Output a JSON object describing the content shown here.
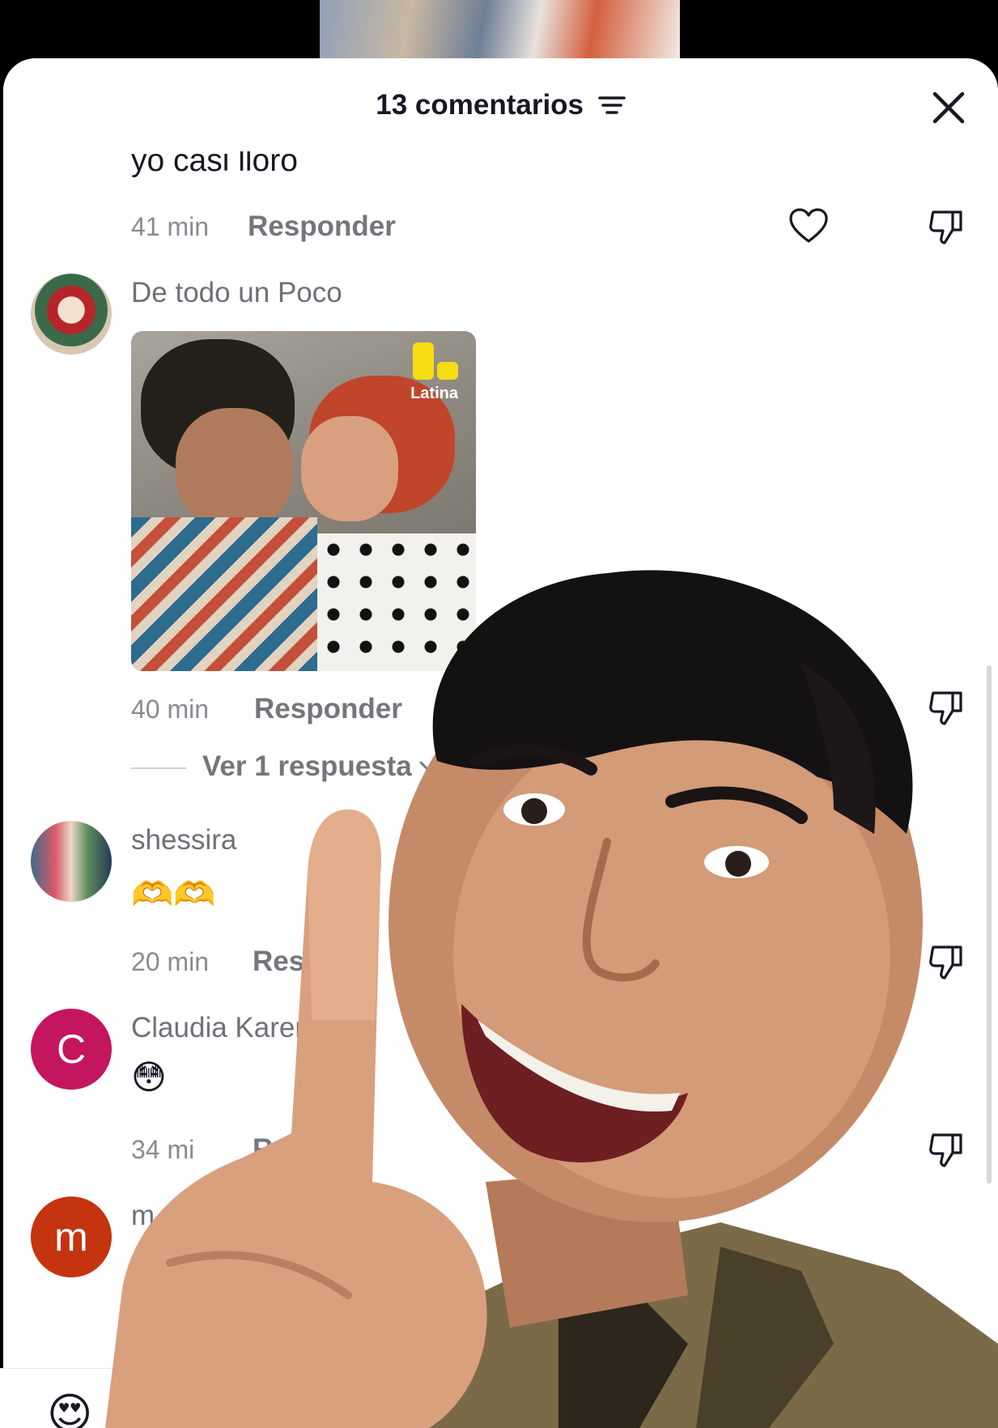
{
  "header": {
    "title": "13 comentarios"
  },
  "comments": [
    {
      "text": "yo casi lloro",
      "time": "41 min",
      "reply": "Responder"
    },
    {
      "name": "De todo un Poco",
      "photo_watermark": "Latina",
      "time": "40 min",
      "reply": "Responder",
      "view_replies": "Ver 1 respuesta"
    },
    {
      "name": "shessira",
      "emoji": "🫶🫶",
      "time": "20 min",
      "reply": "Respon"
    },
    {
      "name": "Claudia Karen",
      "avatar_letter": "C",
      "avatar_color": "#c4155f",
      "emoji": "😳",
      "time": "34 mi",
      "reply": "R"
    },
    {
      "name": "m",
      "avatar_letter": "m",
      "avatar_color": "#c4340e"
    }
  ],
  "bottom_bar": {
    "emoji": "😍"
  },
  "colors": {
    "accent_teal": "#1aa3b0"
  }
}
